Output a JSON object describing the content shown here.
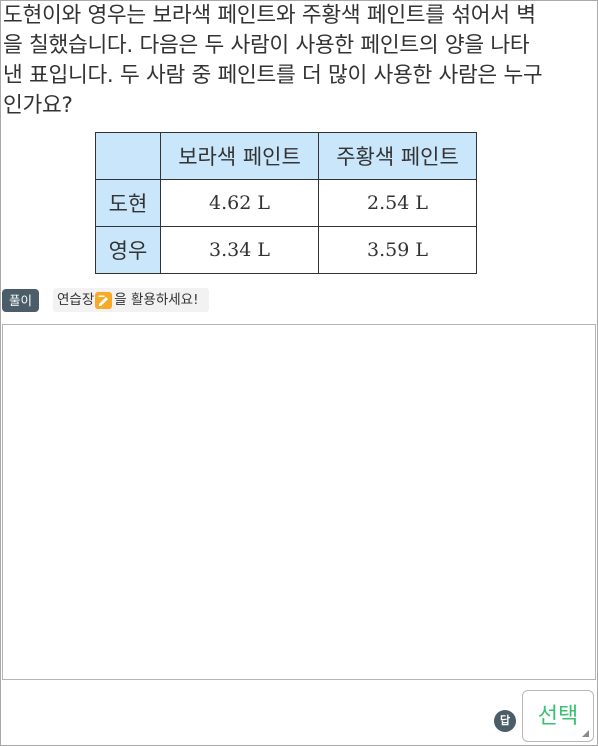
{
  "question": {
    "lines": [
      "도현이와 영우는 보라색 페인트와 주황색 페인트를 섞어서 벽",
      "을 칠했습니다. 다음은 두 사람이 사용한 페인트의 양을 나타",
      "낸 표입니다. 두 사람 중 페인트를 더 많이 사용한 사람은 누구",
      "인가요?"
    ]
  },
  "table": {
    "headers": [
      "",
      "보라색 페인트",
      "주황색 페인트"
    ],
    "rows": [
      {
        "name": "도현",
        "purple": "4.62 L",
        "orange": "2.54 L"
      },
      {
        "name": "영우",
        "purple": "3.34 L",
        "orange": "3.59 L"
      }
    ]
  },
  "solution": {
    "badge": "풀이",
    "note_before": "연습장",
    "note_after": "을 활용하세요!",
    "icon": "pencil-pad-icon"
  },
  "answer": {
    "badge": "답",
    "select_label": "선택"
  },
  "colors": {
    "header_bg": "#c9e6fb",
    "badge_bg": "#4a5d69",
    "select_text": "#38c172",
    "pad_icon": "#f7a928"
  }
}
